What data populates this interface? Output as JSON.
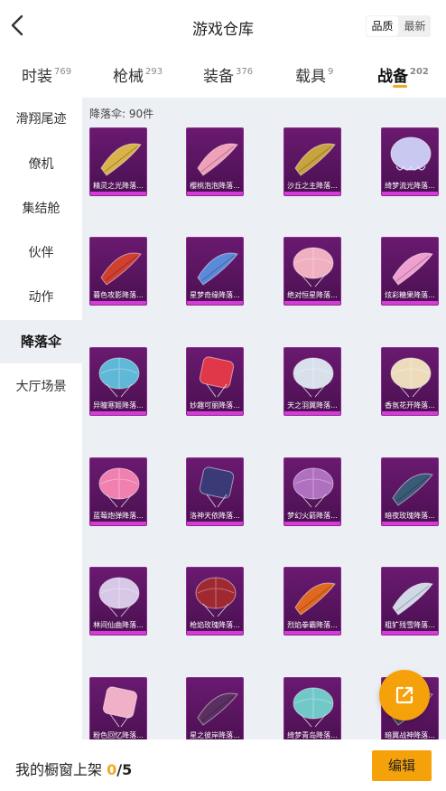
{
  "header": {
    "title": "游戏仓库",
    "sort": {
      "quality": "品质",
      "newest": "最新",
      "selected": "品质"
    }
  },
  "tabs": [
    {
      "label": "时装",
      "count": "769"
    },
    {
      "label": "枪械",
      "count": "293"
    },
    {
      "label": "装备",
      "count": "376"
    },
    {
      "label": "载具",
      "count": "9"
    },
    {
      "label": "战备",
      "count": "202",
      "active": true
    }
  ],
  "sidebar": {
    "items": [
      {
        "label": "滑翔尾迹"
      },
      {
        "label": "僚机"
      },
      {
        "label": "集结舱"
      },
      {
        "label": "伙伴"
      },
      {
        "label": "动作"
      },
      {
        "label": "降落伞",
        "active": true
      },
      {
        "label": "大厅场景"
      }
    ]
  },
  "content": {
    "count_label": "降落伞: 90件",
    "items": [
      {
        "name": "精灵之光降落...",
        "icon": "golden-wing-glider",
        "color": "#d9b24a"
      },
      {
        "name": "樱桃泡泡降落...",
        "icon": "pink-wing-glider",
        "color": "#f0a0b8"
      },
      {
        "name": "沙丘之主降落...",
        "icon": "golden-wing-glider",
        "color": "#c9a43e"
      },
      {
        "name": "绮梦流光降落...",
        "icon": "jellyfish-parachute",
        "color": "#c8c8f0"
      },
      {
        "name": "暮色攻影降落...",
        "icon": "red-wing-glider",
        "color": "#d04030"
      },
      {
        "name": "星梦奇缘降落...",
        "icon": "blue-wing-glider",
        "color": "#5a8ad8"
      },
      {
        "name": "绝对恒星降落...",
        "icon": "pink-round-parachute",
        "color": "#f0b0c0"
      },
      {
        "name": "炫彩糖果降落...",
        "icon": "pink-wing-glider",
        "color": "#f0a0d0"
      },
      {
        "name": "异瞳寒姬降落...",
        "icon": "blue-round-parachute",
        "color": "#60b8d8"
      },
      {
        "name": "妙趣可丽降落...",
        "icon": "red-square-parachute",
        "color": "#e03848"
      },
      {
        "name": "天之羽翼降落...",
        "icon": "white-round-parachute",
        "color": "#d8e0ec"
      },
      {
        "name": "香氛花开降落...",
        "icon": "cream-round-parachute",
        "color": "#ecdcbc"
      },
      {
        "name": "蓝莓炮弹降落...",
        "icon": "pink-round-parachute",
        "color": "#f080b0"
      },
      {
        "name": "洛神天依降落...",
        "icon": "dark-square-parachute",
        "color": "#3a3a78"
      },
      {
        "name": "梦幻火箭降落...",
        "icon": "purple-round-parachute",
        "color": "#b070c0"
      },
      {
        "name": "暗夜玫瑰降落...",
        "icon": "dark-wing-glider",
        "color": "#3a5a78"
      },
      {
        "name": "林间仙曲降落...",
        "icon": "striped-round-parachute",
        "color": "#d8c8e8"
      },
      {
        "name": "枪焰玫瑰降落...",
        "icon": "red-dark-parachute",
        "color": "#a02830"
      },
      {
        "name": "烈焰拳霸降落...",
        "icon": "orange-wing-glider",
        "color": "#e06820"
      },
      {
        "name": "粗犷残雪降落...",
        "icon": "silver-wing-glider",
        "color": "#d0d8e8"
      },
      {
        "name": "粉色回忆降落...",
        "icon": "pink-square-parachute",
        "color": "#f0b0c8"
      },
      {
        "name": "星之彼岸降落...",
        "icon": "dark-wing-glider",
        "color": "#5a3060"
      },
      {
        "name": "绮梦青岛降落...",
        "icon": "teal-round-parachute",
        "color": "#70c8c8"
      },
      {
        "name": "暗翼战神降落...",
        "icon": "dark-wing-glider",
        "color": "#404858"
      }
    ]
  },
  "fab": {
    "icon": "share-external-icon"
  },
  "bottom": {
    "label": "我的橱窗上架",
    "current": "0",
    "separator": "/",
    "max": "5",
    "edit_label": "编辑"
  }
}
